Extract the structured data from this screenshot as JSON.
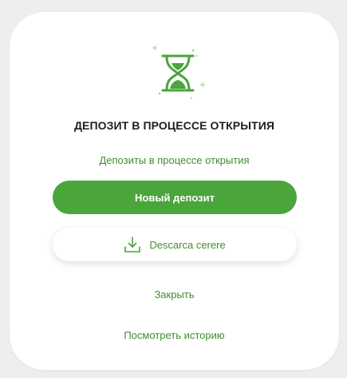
{
  "dialog": {
    "title": "ДЕПОЗИТ В ПРОЦЕССЕ ОТКРЫТИЯ",
    "subtitle": "Депозиты в процессе открытия",
    "icon": "hourglass-icon",
    "primary_button_label": "Новый депозит",
    "download_button_label": "Descarca cerere",
    "download_icon": "download-icon",
    "close_label": "Закрыть",
    "history_label": "Посмотреть историю"
  },
  "colors": {
    "accent": "#4aa53a",
    "accent_text": "#3e8e2e",
    "background": "#eeeef0",
    "card": "#ffffff"
  }
}
